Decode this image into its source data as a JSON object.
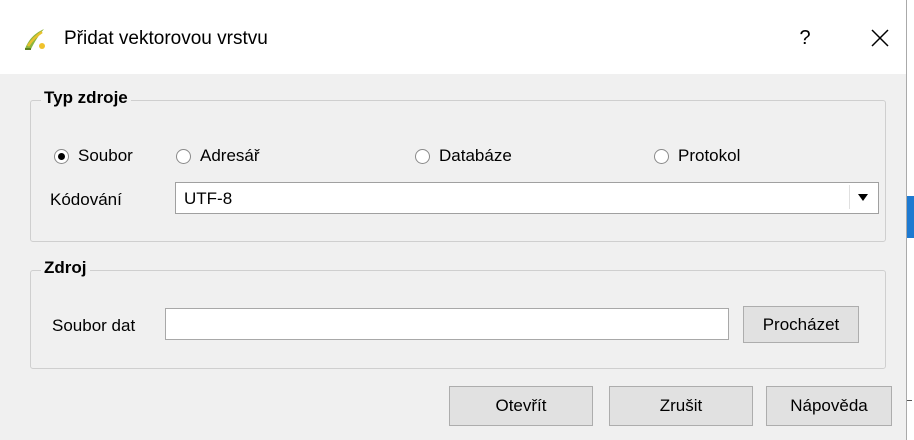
{
  "window": {
    "title": "Přidat vektorovou vrstvu",
    "help_label": "?",
    "close_label": "✕",
    "app_icon": "qgis-icon"
  },
  "source_type": {
    "group_title": "Typ zdroje",
    "options": [
      {
        "label": "Soubor",
        "checked": true
      },
      {
        "label": "Adresář",
        "checked": false
      },
      {
        "label": "Databáze",
        "checked": false
      },
      {
        "label": "Protokol",
        "checked": false
      }
    ],
    "encoding_label": "Kódování",
    "encoding_value": "UTF-8"
  },
  "source": {
    "group_title": "Zdroj",
    "file_label": "Soubor dat",
    "file_value": "",
    "browse_label": "Procházet"
  },
  "buttons": {
    "open_label": "Otevřít",
    "cancel_label": "Zrušit",
    "help_label": "Nápověda"
  },
  "colors": {
    "accent": "#1e7ad1",
    "dialog_bg": "#f0f0f0"
  }
}
